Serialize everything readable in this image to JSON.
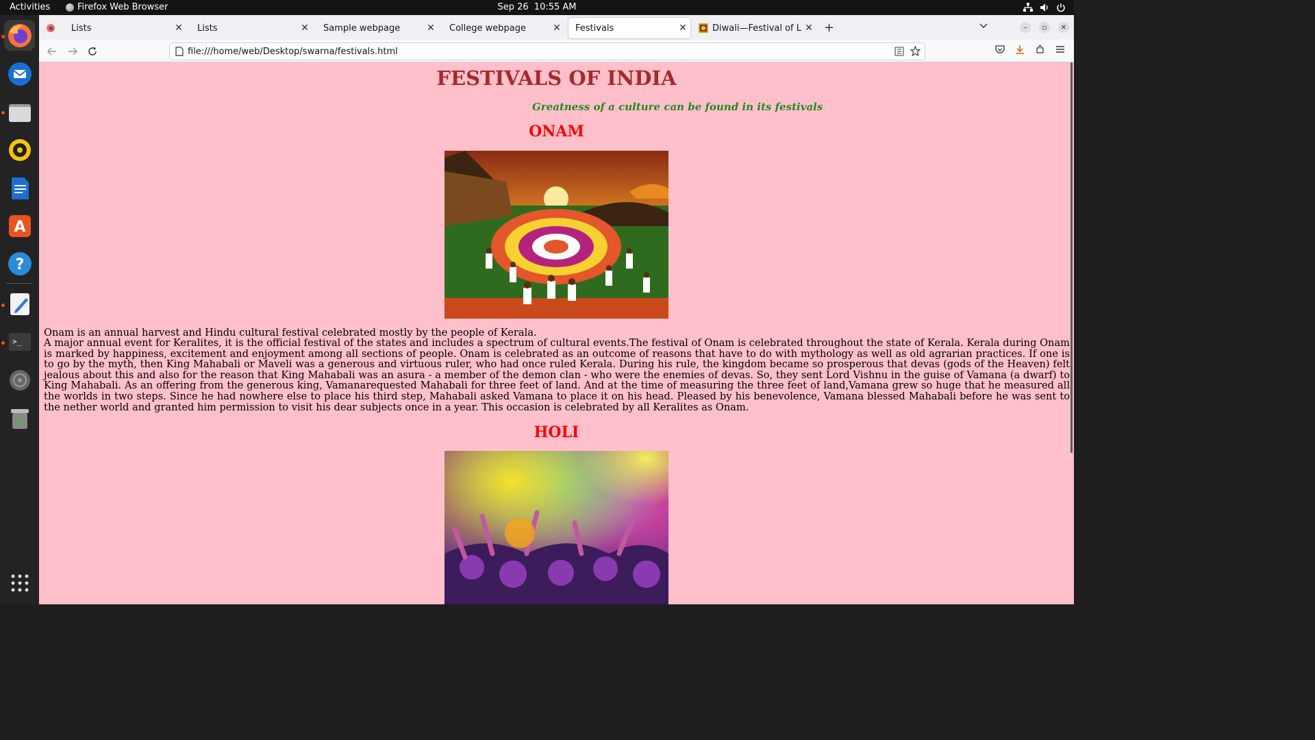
{
  "topbar": {
    "activities": "Activities",
    "app_name": "Firefox Web Browser",
    "date": "Sep 26",
    "time": "10:55 AM"
  },
  "dock": {
    "items": [
      "firefox-icon",
      "thunderbird-icon",
      "files-icon",
      "rhythmbox-icon",
      "writer-icon",
      "app-center-icon",
      "help-icon",
      "text-editor-icon",
      "terminal-icon",
      "disc-icon",
      "trash-icon",
      "show-apps-icon"
    ]
  },
  "tabs": [
    {
      "label": "Lists"
    },
    {
      "label": "Lists"
    },
    {
      "label": "Sample webpage"
    },
    {
      "label": "College webpage"
    },
    {
      "label": "Festivals"
    },
    {
      "label": "Diwali—Festival of Lights"
    }
  ],
  "urlbar": {
    "url": "file:///home/web/Desktop/swarna/festivals.html"
  },
  "page": {
    "title": "FESTIVALS OF INDIA",
    "subtitle": "Greatness of a culture can be found in its festivals",
    "colors": {
      "background": "#ffc0cb",
      "title": "#a52a2a",
      "subtitle": "#228b22",
      "heading": "#ff0000"
    },
    "festivals": [
      {
        "name": "ONAM",
        "intro": "Onam is an annual harvest and Hindu cultural festival celebrated mostly by the people of Kerala.",
        "body": "A major annual event for Keralites, it is the official festival of the states and includes a spectrum of cultural events.The festival of Onam is celebrated throughout the state of Kerala. Kerala during Onam is marked by happiness, excitement and enjoyment among all sections of people. Onam is celebrated as an outcome of reasons that have to do with mythology as well as old agrarian practices. If one is to go by the myth, then King Mahabali or Maveli was a generous and virtuous ruler, who had once ruled Kerala. During his rule, the kingdom became so prosperous that devas (gods of the Heaven) felt jealous about this and also for the reason that King Mahabali was an asura - a member of the demon clan - who were the enemies of devas. So, they sent Lord Vishnu in the guise of Vamana (a dwarf) to King Mahabali. As an offering from the generous king, Vamanarequested Mahabali for three feet of land. And at the time of measuring the three feet of land,Vamana grew so huge that he measured all the worlds in two steps. Since he had nowhere else to place his third step, Mahabali asked Vamana to place it on his head. Pleased by his benevolence, Vamana blessed Mahabali before he was sent to the nether world and granted him permission to visit his dear subjects once in a year. This occasion is celebrated by all Keralites as Onam."
      },
      {
        "name": "HOLI"
      }
    ]
  }
}
